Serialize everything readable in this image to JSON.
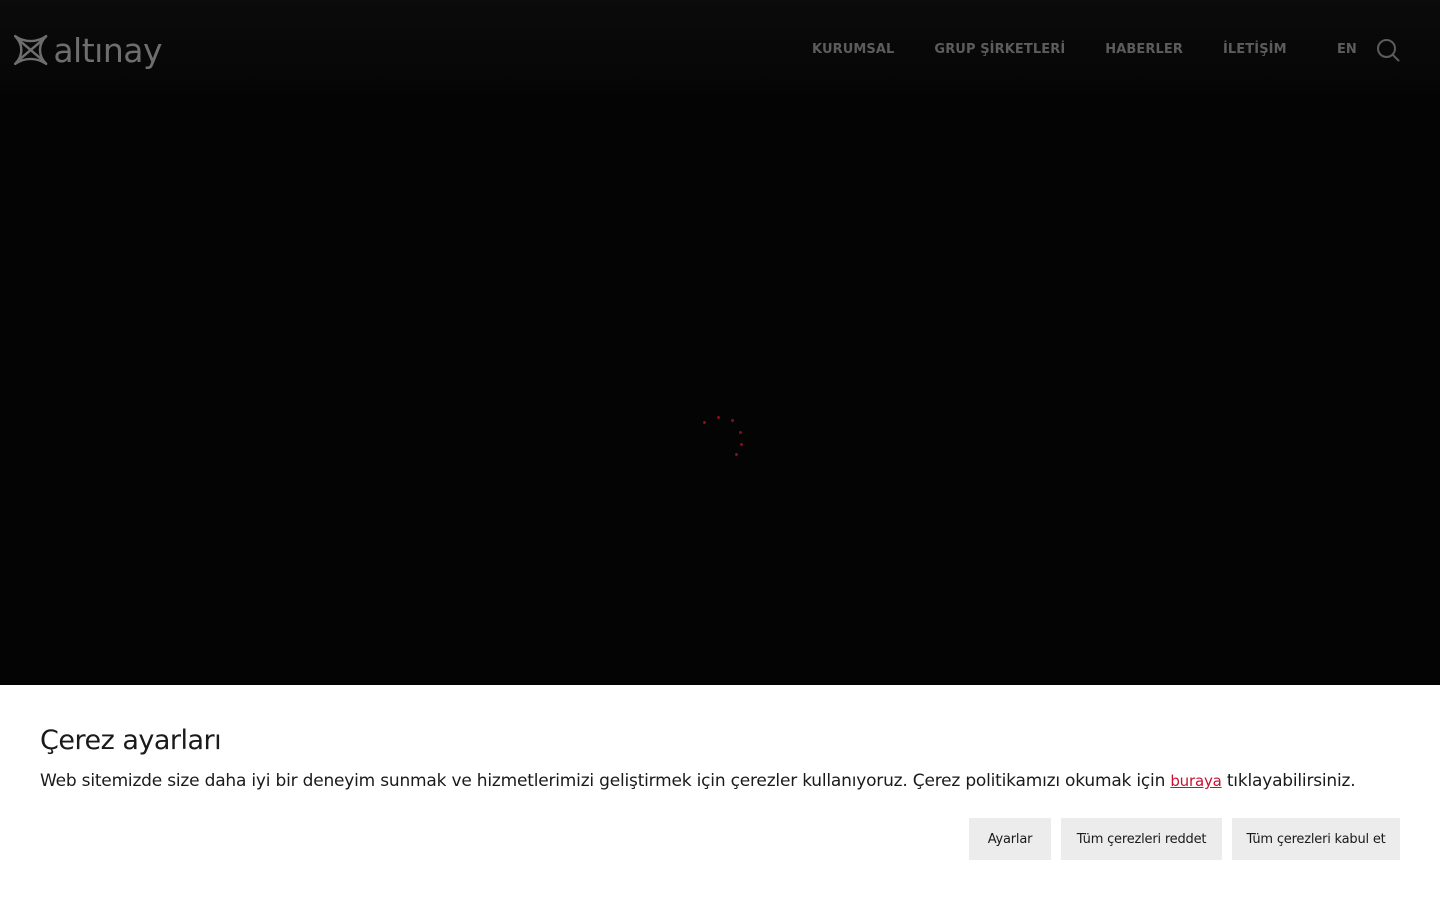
{
  "header": {
    "logo_text": "altınay",
    "nav": [
      {
        "label": "KURUMSAL"
      },
      {
        "label": "GRUP ŞİRKETLERİ"
      },
      {
        "label": "HABERLER"
      },
      {
        "label": "İLETİŞİM"
      }
    ],
    "language": "EN",
    "search_icon": "search-icon"
  },
  "loader": {
    "icon": "loading-spinner-icon",
    "color": "#8a0b22"
  },
  "cookie_banner": {
    "title": "Çerez ayarları",
    "text_before_link": "Web sitemizde size daha iyi bir deneyim sunmak ve hizmetlerimizi geliştirmek için çerezler kullanıyoruz. Çerez politikamızı okumak için ",
    "link_text": "buraya",
    "text_after_link": " tıklayabilirsiniz.",
    "buttons": {
      "settings": "Ayarlar",
      "reject_all": "Tüm çerezleri reddet",
      "accept_all": "Tüm çerezleri kabul et"
    },
    "accent_color": "#c8102e"
  }
}
